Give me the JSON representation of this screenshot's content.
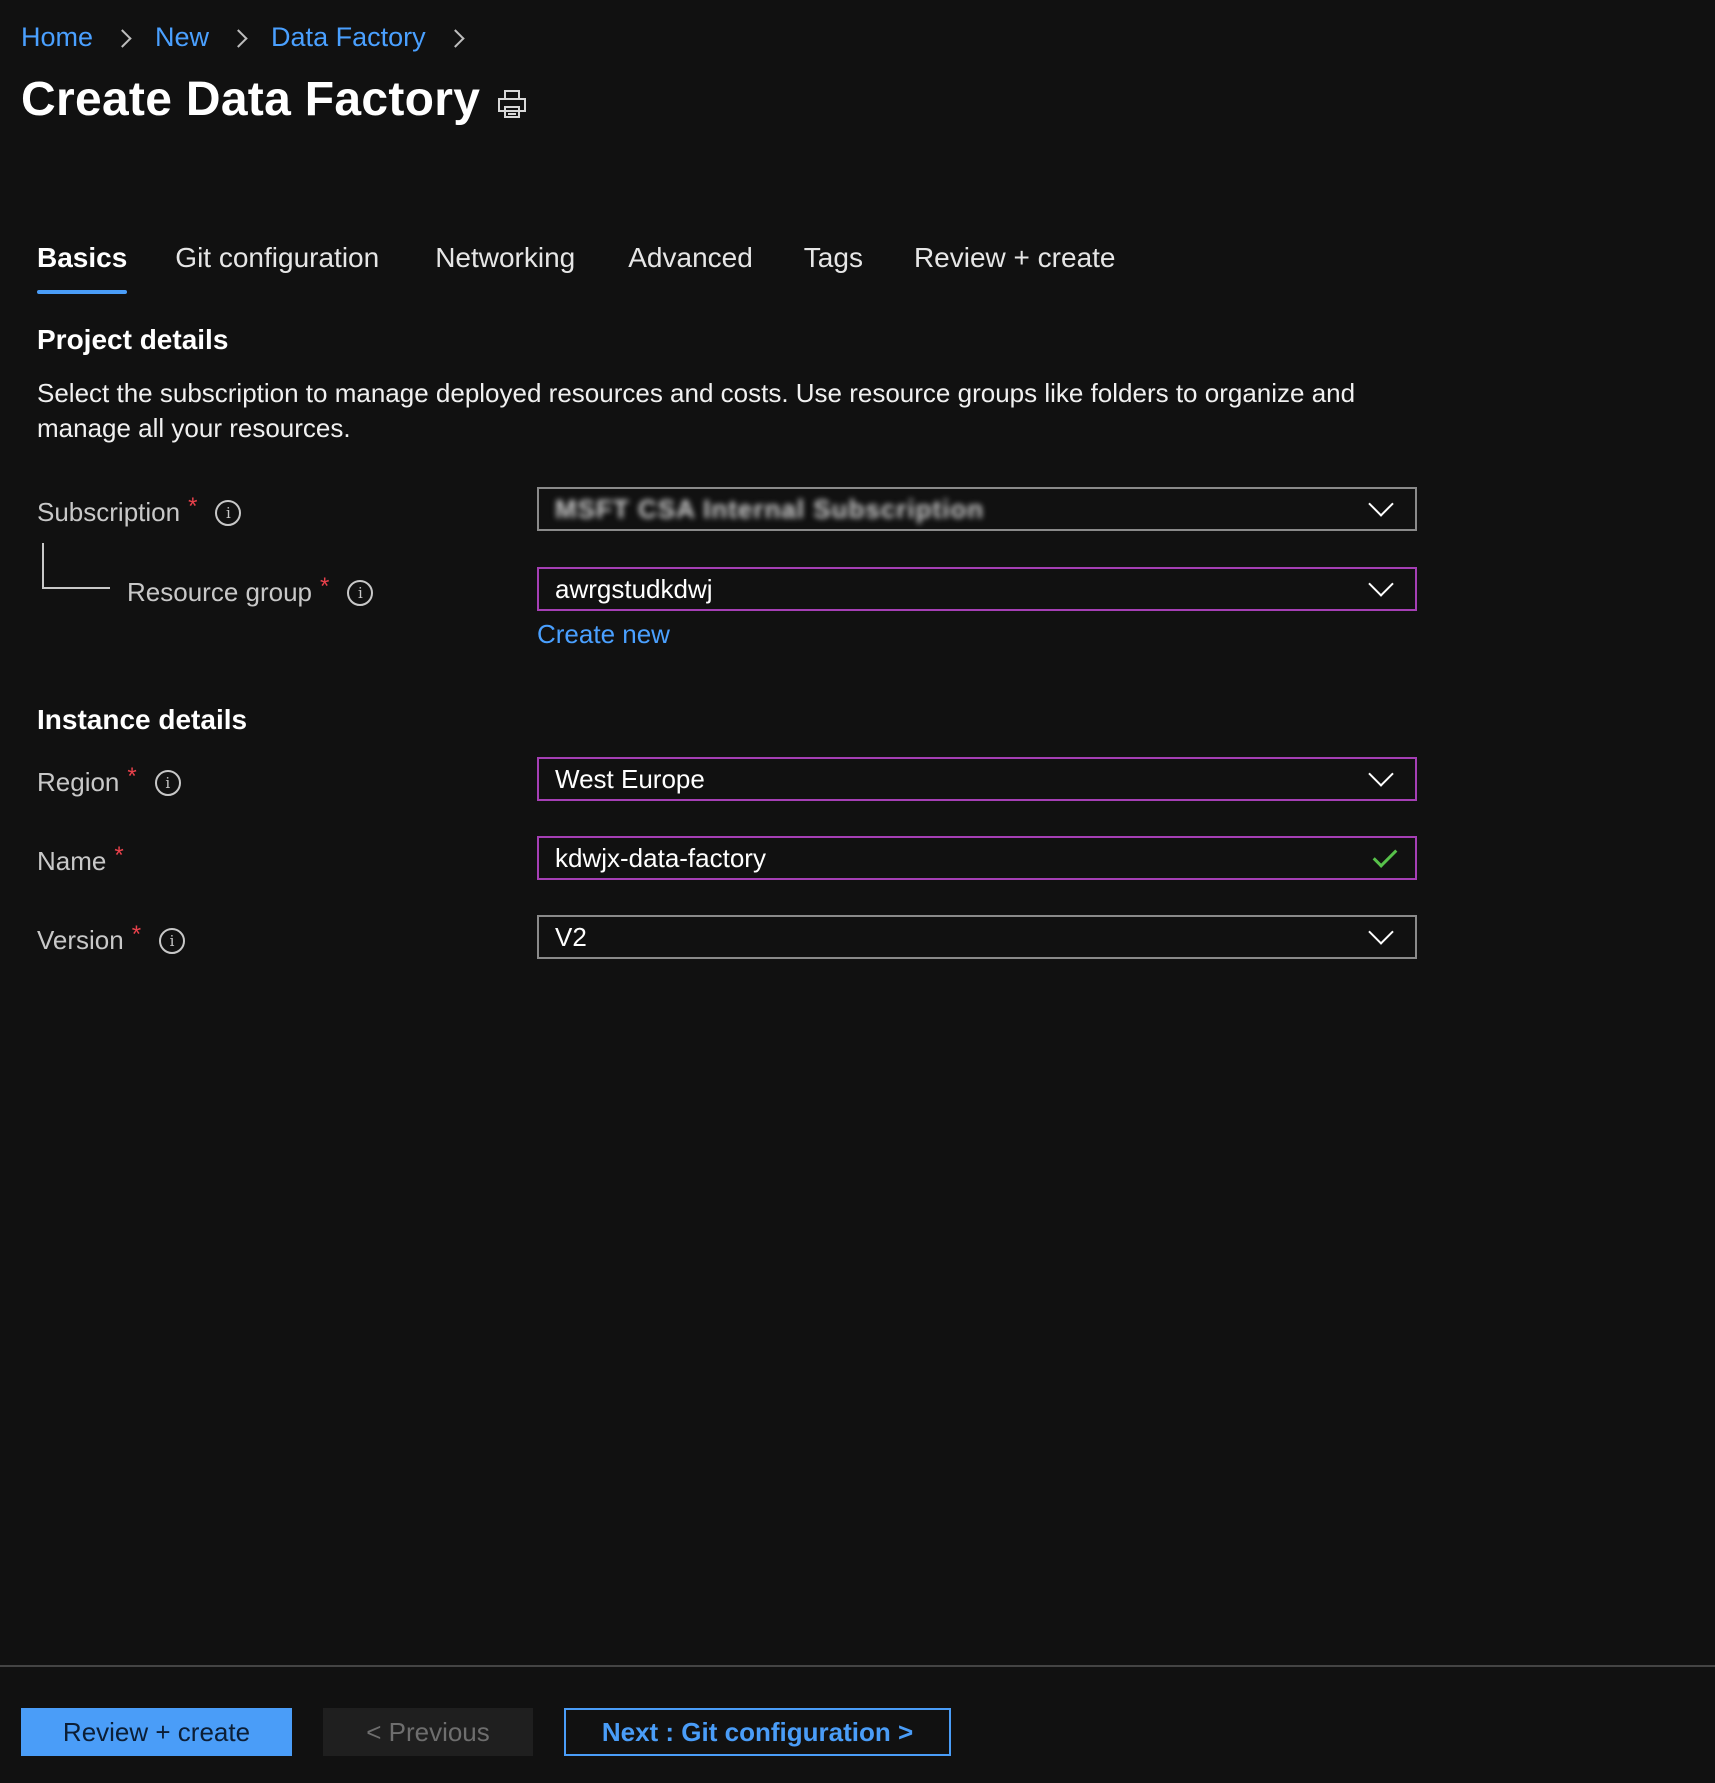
{
  "breadcrumb": {
    "items": [
      "Home",
      "New",
      "Data Factory"
    ]
  },
  "page": {
    "title": "Create Data Factory"
  },
  "tabs": [
    {
      "label": "Basics",
      "active": true
    },
    {
      "label": "Git configuration",
      "active": false
    },
    {
      "label": "Networking",
      "active": false
    },
    {
      "label": "Advanced",
      "active": false
    },
    {
      "label": "Tags",
      "active": false
    },
    {
      "label": "Review + create",
      "active": false
    }
  ],
  "project": {
    "heading": "Project details",
    "description": "Select the subscription to manage deployed resources and costs. Use resource groups like folders to organize and manage all your resources.",
    "subscription": {
      "label": "Subscription",
      "required": "*",
      "value": "MSFT CSA Internal Subscription"
    },
    "resource_group": {
      "label": "Resource group",
      "required": "*",
      "value": "awrgstudkdwj",
      "create_new": "Create new"
    }
  },
  "instance": {
    "heading": "Instance details",
    "region": {
      "label": "Region",
      "required": "*",
      "value": "West Europe"
    },
    "name": {
      "label": "Name",
      "required": "*",
      "value": "kdwjx-data-factory"
    },
    "version": {
      "label": "Version",
      "required": "*",
      "value": "V2"
    }
  },
  "footer": {
    "review_create": "Review + create",
    "previous": "< Previous",
    "next": "Next : Git configuration >"
  },
  "colors": {
    "accent": "#4a9df8",
    "focus_border": "#a53fb5",
    "required": "#e8414b",
    "valid": "#57c14a"
  }
}
